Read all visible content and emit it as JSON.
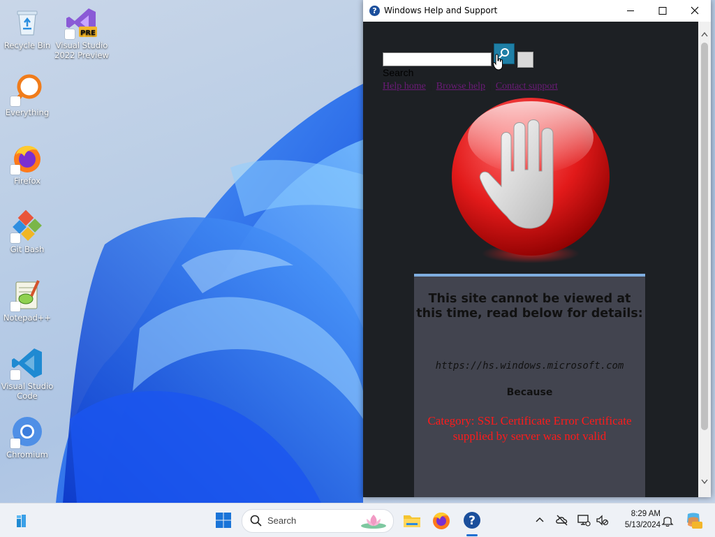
{
  "desktop": {
    "icons": [
      {
        "label": "Recycle Bin"
      },
      {
        "label": "Visual Studio 2022 Preview",
        "badge": "PRE"
      },
      {
        "label": "Everything"
      },
      {
        "label": "Firefox"
      },
      {
        "label": "Git Bash"
      },
      {
        "label": "Notepad++"
      },
      {
        "label": "Visual Studio Code"
      },
      {
        "label": "Chromium"
      }
    ]
  },
  "window": {
    "title": "Windows Help and Support",
    "search": {
      "value": "",
      "label": "Search"
    },
    "links": [
      "Help home",
      "Browse help",
      "Contact support"
    ],
    "link_separator": "|",
    "error_panel": {
      "title": "This site cannot be viewed at this time, read below for details:",
      "url": "https://hs.windows.microsoft.com",
      "because": "Because",
      "error": "Category: SSL Certificate Error Certificate supplied by server was not valid"
    }
  },
  "taskbar": {
    "search_label": "Search",
    "clock_time": "8:29 AM",
    "clock_date": "5/13/2024"
  },
  "colors": {
    "content_bg": "#1d2024",
    "panel_bg": "#42444f",
    "panel_accent": "#7faee0",
    "error_text": "#ff1b1b",
    "link": "#6b1b78",
    "search_button": "#1f7fa6"
  }
}
